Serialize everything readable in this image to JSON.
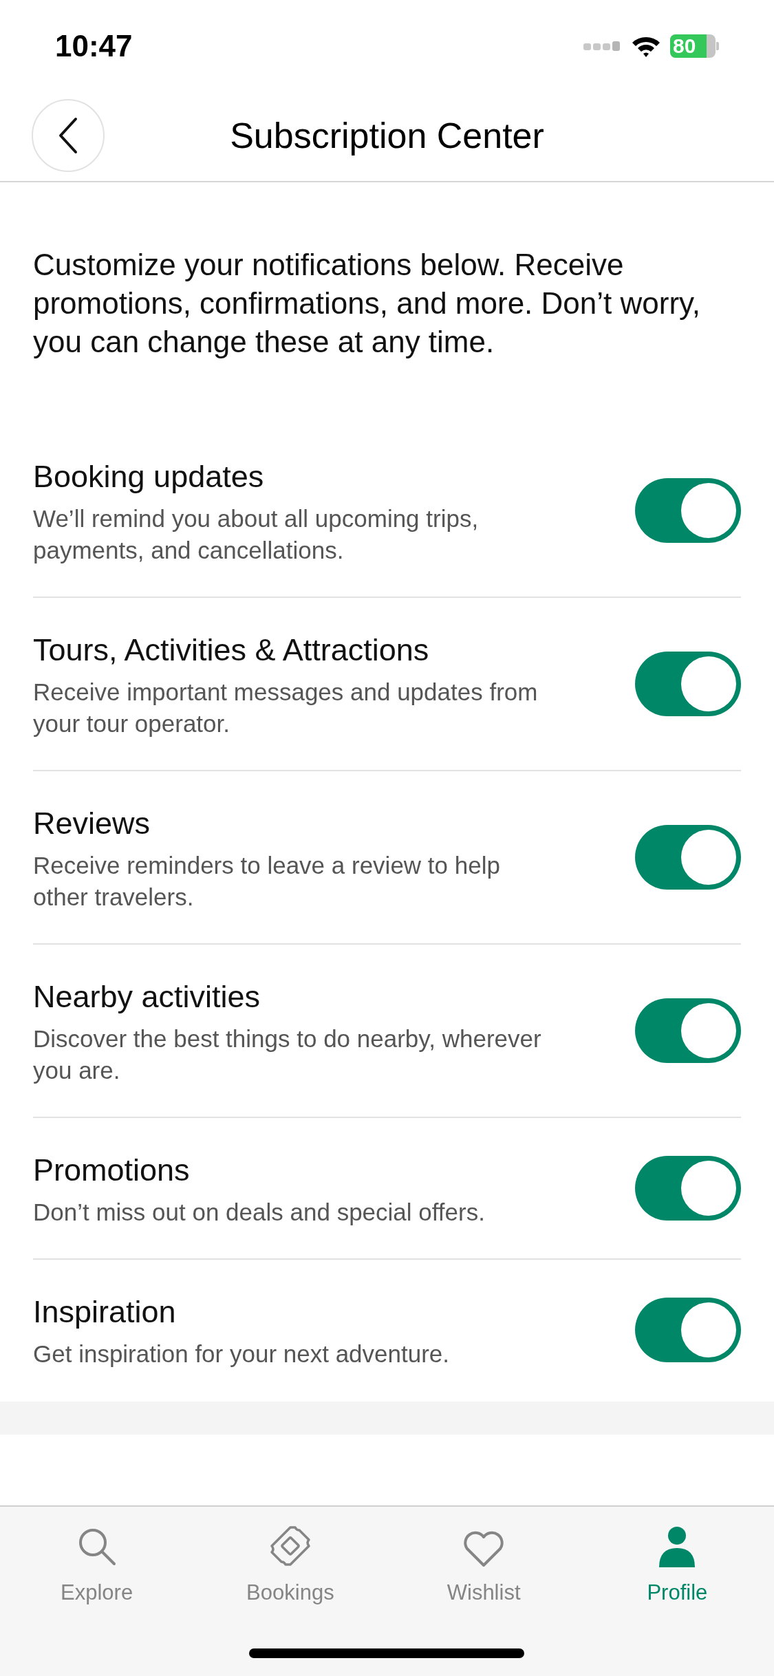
{
  "status_bar": {
    "time": "10:47",
    "battery": "80"
  },
  "header": {
    "title": "Subscription Center"
  },
  "intro": "Customize your notifications below. Receive promotions, confirmations, and more. Don’t worry, you can change these at any time.",
  "settings": [
    {
      "title": "Booking updates",
      "description": "We’ll remind you about all upcoming trips, payments, and cancellations.",
      "on": true
    },
    {
      "title": "Tours, Activities & Attractions",
      "description": "Receive important messages and updates from your tour operator.",
      "on": true
    },
    {
      "title": "Reviews",
      "description": "Receive reminders to leave a review to help other travelers.",
      "on": true
    },
    {
      "title": "Nearby activities",
      "description": "Discover the best things to do nearby, wherever you are.",
      "on": true
    },
    {
      "title": "Promotions",
      "description": "Don’t miss out on deals and special offers.",
      "on": true
    },
    {
      "title": "Inspiration",
      "description": "Get inspiration for your next adventure.",
      "on": true
    }
  ],
  "tab_bar": [
    {
      "label": "Explore",
      "kind": "search",
      "selected": false
    },
    {
      "label": "Bookings",
      "kind": "ticket",
      "selected": false
    },
    {
      "label": "Wishlist",
      "kind": "heart",
      "selected": false
    },
    {
      "label": "Profile",
      "kind": "person",
      "selected": true
    }
  ]
}
